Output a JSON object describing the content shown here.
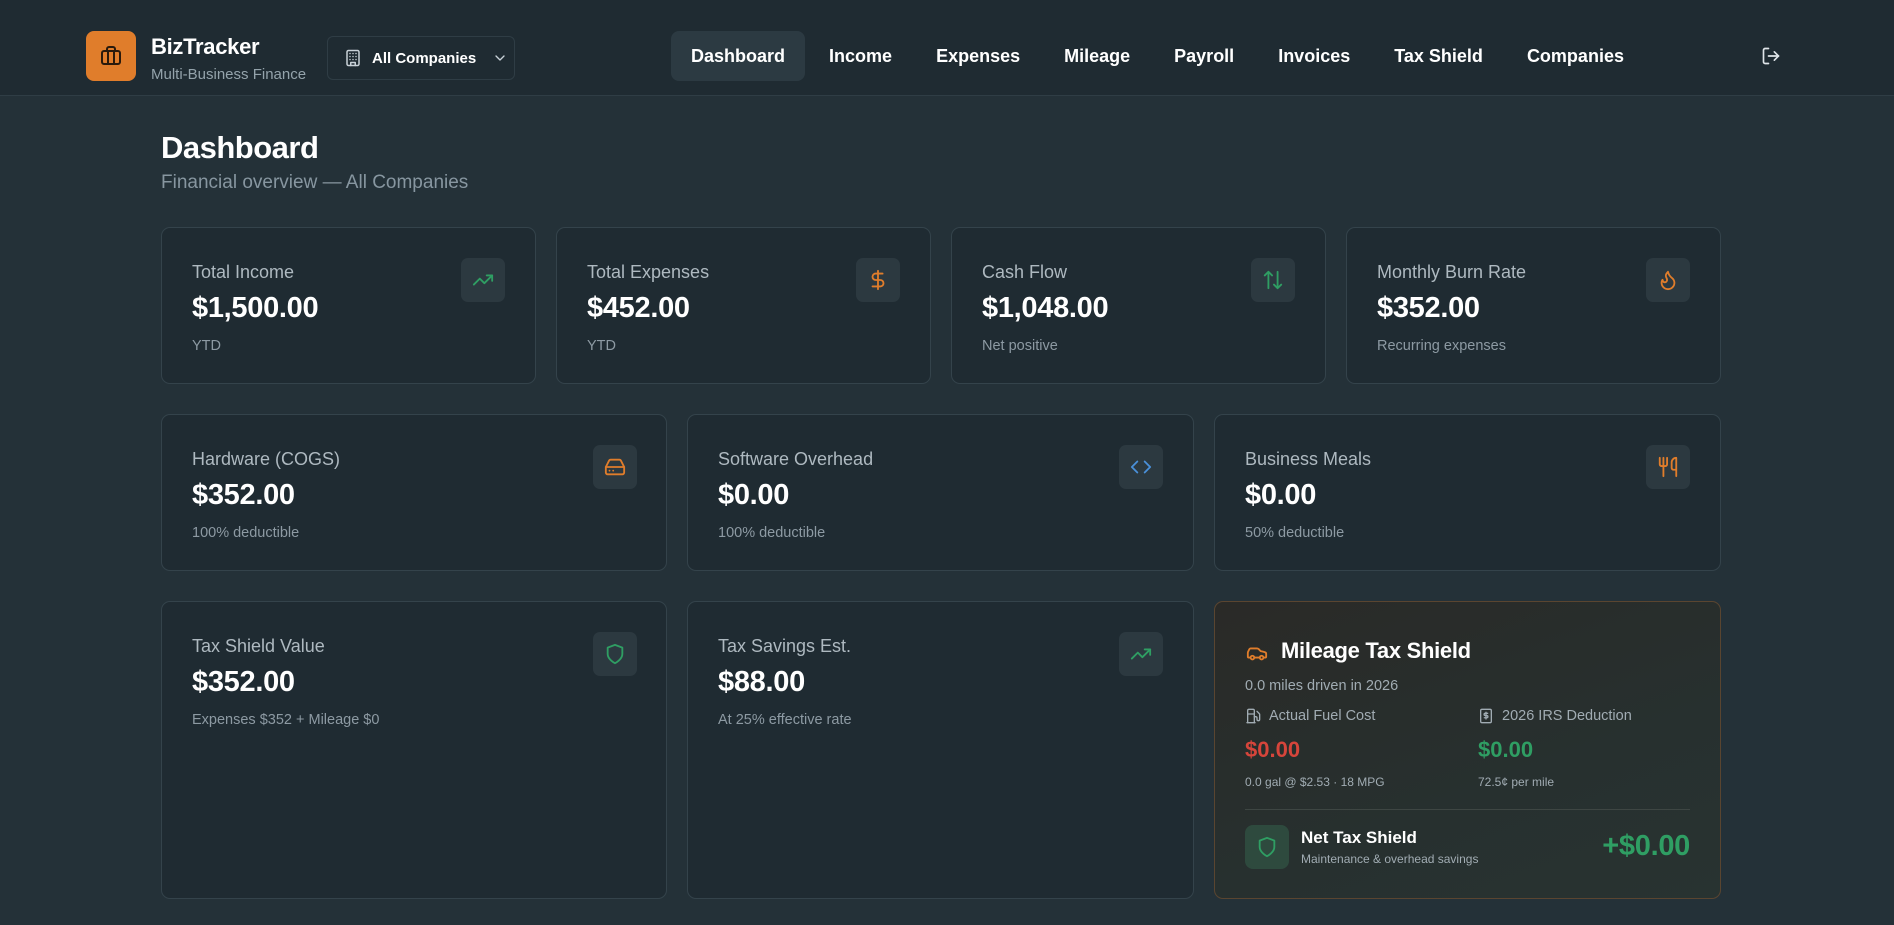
{
  "brand": {
    "name": "BizTracker",
    "subtitle": "Multi-Business Finance",
    "accent": "#e07d2b"
  },
  "company_selector": {
    "value": "All Companies"
  },
  "nav": {
    "items": [
      "Dashboard",
      "Income",
      "Expenses",
      "Mileage",
      "Payroll",
      "Invoices",
      "Tax Shield",
      "Companies"
    ],
    "active": "Dashboard"
  },
  "header": {
    "title": "Dashboard",
    "subtitle": "Financial overview — All Companies"
  },
  "stats_row1": [
    {
      "label": "Total Income",
      "value": "$1,500.00",
      "sub": "YTD",
      "icon": "trending-up-icon",
      "icon_color": "#2f9e63"
    },
    {
      "label": "Total Expenses",
      "value": "$452.00",
      "sub": "YTD",
      "icon": "dollar-icon",
      "icon_color": "#e07d2b"
    },
    {
      "label": "Cash Flow",
      "value": "$1,048.00",
      "sub": "Net positive",
      "icon": "arrows-up-down-icon",
      "icon_color": "#2f9e63"
    },
    {
      "label": "Monthly Burn Rate",
      "value": "$352.00",
      "sub": "Recurring expenses",
      "icon": "flame-icon",
      "icon_color": "#e07d2b"
    }
  ],
  "stats_row2": [
    {
      "label": "Hardware (COGS)",
      "value": "$352.00",
      "sub": "100% deductible",
      "icon": "hard-drive-icon",
      "icon_color": "#e07d2b"
    },
    {
      "label": "Software Overhead",
      "value": "$0.00",
      "sub": "100% deductible",
      "icon": "code-icon",
      "icon_color": "#4a90d9"
    },
    {
      "label": "Business Meals",
      "value": "$0.00",
      "sub": "50% deductible",
      "icon": "utensils-icon",
      "icon_color": "#e07d2b"
    }
  ],
  "stats_row3": [
    {
      "label": "Tax Shield Value",
      "value": "$352.00",
      "sub": "Expenses $352 + Mileage $0",
      "icon": "shield-icon",
      "icon_color": "#2f9e63"
    },
    {
      "label": "Tax Savings Est.",
      "value": "$88.00",
      "sub": "At 25% effective rate",
      "icon": "trending-up-icon",
      "icon_color": "#2f9e63"
    }
  ],
  "mileage": {
    "title": "Mileage Tax Shield",
    "subtitle": "0.0 miles driven in 2026",
    "fuel_label": "Actual Fuel Cost",
    "fuel_value": "$0.00",
    "fuel_note": "0.0 gal @ $2.53 · 18 MPG",
    "irs_label": "2026 IRS Deduction",
    "irs_value": "$0.00",
    "irs_note": "72.5¢ per mile",
    "net_title": "Net Tax Shield",
    "net_sub": "Maintenance & overhead savings",
    "net_value": "+$0.00",
    "colors": {
      "negative": "#d6453b",
      "positive": "#2f9e63"
    }
  }
}
